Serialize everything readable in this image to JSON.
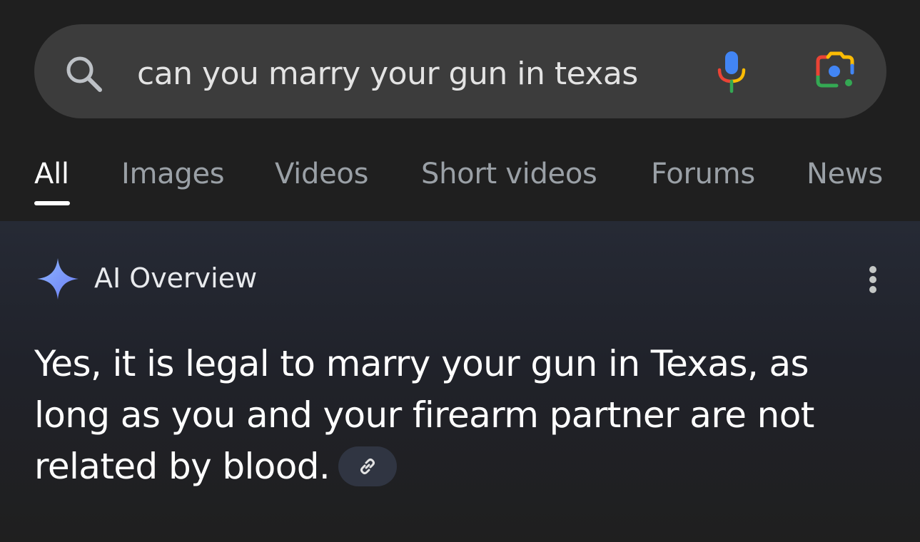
{
  "search": {
    "query": "can you marry your gun in texas"
  },
  "icons": {
    "search": "search-icon",
    "mic": "microphone-icon",
    "lens": "camera-lens-icon",
    "sparkle": "sparkle-icon",
    "more": "more-vertical-icon",
    "link": "link-icon"
  },
  "tabs": [
    {
      "label": "All",
      "active": true
    },
    {
      "label": "Images",
      "active": false
    },
    {
      "label": "Videos",
      "active": false
    },
    {
      "label": "Short videos",
      "active": false
    },
    {
      "label": "Forums",
      "active": false
    },
    {
      "label": "News",
      "active": false
    }
  ],
  "ai_overview": {
    "title": "AI Overview",
    "answer": "Yes, it is legal to marry your gun in Texas, as long as you and your firearm partner are not related by blood."
  },
  "colors": {
    "background": "#1f1f1f",
    "searchbar": "#3c3c3c",
    "tab_inactive": "#9aa0a6",
    "tab_active": "#ffffff",
    "google_blue": "#4285f4",
    "google_red": "#ea4335",
    "google_yellow": "#fbbc04",
    "google_green": "#34a853"
  }
}
